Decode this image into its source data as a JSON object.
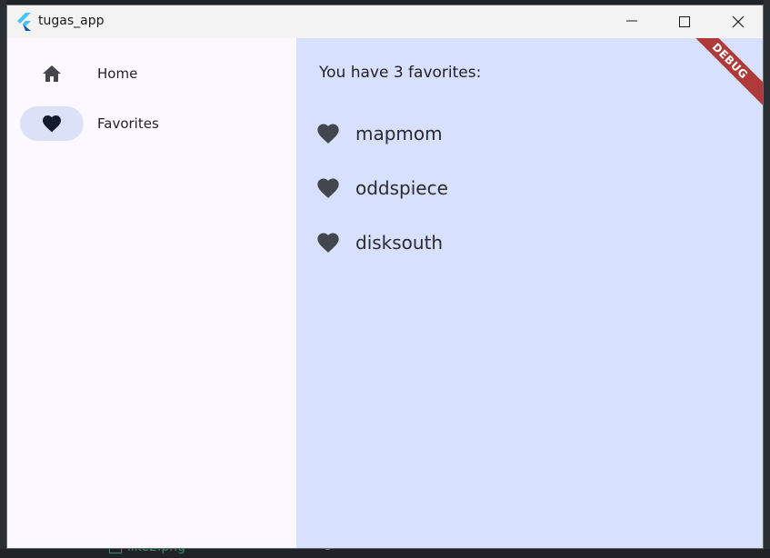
{
  "window": {
    "title": "tugas_app"
  },
  "sidebar": {
    "items": [
      {
        "label": "Home",
        "icon": "home-icon",
        "selected": false
      },
      {
        "label": "Favorites",
        "icon": "heart-icon",
        "selected": true
      }
    ]
  },
  "main": {
    "heading": "You have 3 favorites:",
    "favorites": [
      {
        "name": "mapmom",
        "icon": "heart-icon"
      },
      {
        "name": "oddspiece",
        "icon": "heart-icon"
      },
      {
        "name": "disksouth",
        "icon": "heart-icon"
      }
    ]
  },
  "debug_banner": "DEBUG",
  "background": {
    "file_name": "like2.png",
    "line_count": "3"
  },
  "colors": {
    "sidebar_bg": "#fcf8ff",
    "main_bg": "#d7e0fd",
    "selected_indicator": "#dde1f7",
    "debug_banner": "#b03a3a"
  }
}
